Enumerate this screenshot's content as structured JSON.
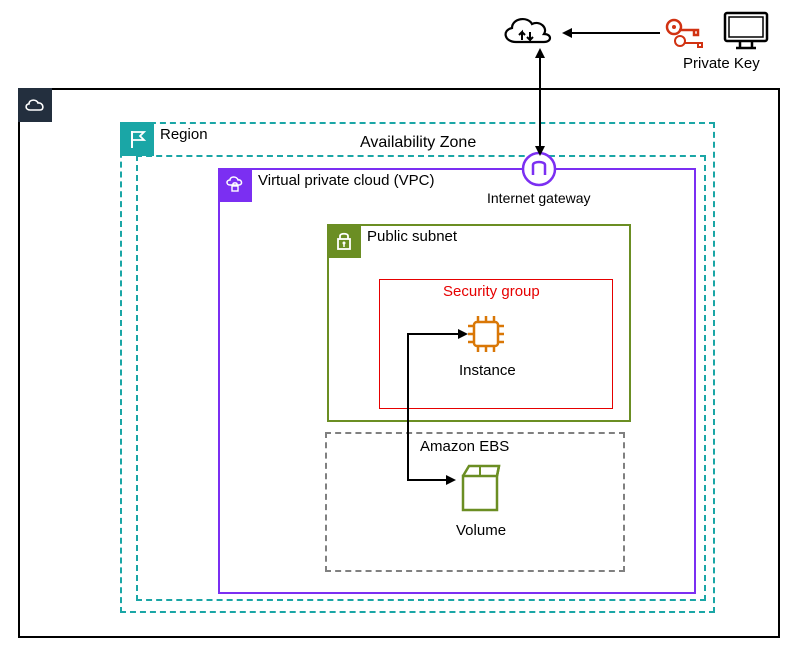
{
  "labels": {
    "private_key": "Private Key",
    "region": "Region",
    "availability_zone": "Availability Zone",
    "vpc": "Virtual private cloud (VPC)",
    "internet_gateway": "Internet gateway",
    "public_subnet": "Public subnet",
    "security_group": "Security group",
    "instance": "Instance",
    "amazon_ebs": "Amazon EBS",
    "volume": "Volume"
  },
  "colors": {
    "teal": "#1aa6a6",
    "purple": "#7b2ff2",
    "olive": "#6b8e23",
    "red": "#e60000",
    "orange": "#d97706",
    "gray": "#808080",
    "dark": "#232f3e",
    "key_red": "#d13212"
  }
}
